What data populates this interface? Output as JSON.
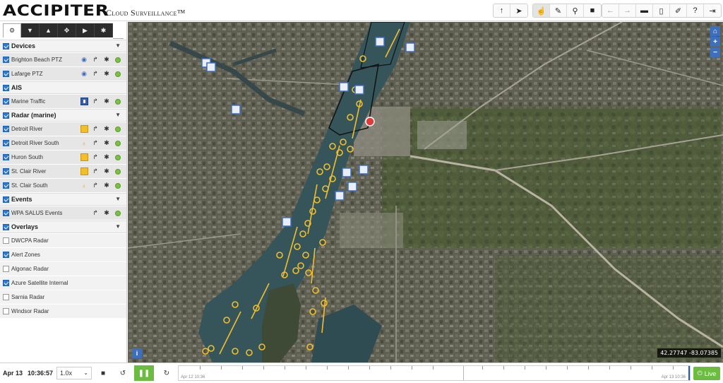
{
  "header": {
    "logo_text": "ACCIPITER",
    "product_name": "Cloud Surveillance™",
    "toolbar_left": [
      {
        "icon": "upload-arrow-icon",
        "glyph": "↑"
      },
      {
        "icon": "tag-icon",
        "glyph": "➤"
      }
    ],
    "toolbar_draw": [
      {
        "icon": "hand-pointer-icon",
        "glyph": "☝"
      },
      {
        "icon": "pencil-icon",
        "glyph": "✎"
      },
      {
        "icon": "map-pin-icon",
        "glyph": "⚲"
      },
      {
        "icon": "video-camera-icon",
        "glyph": "■"
      }
    ],
    "toolbar_right": [
      {
        "icon": "back-arrow-icon",
        "glyph": "←"
      },
      {
        "icon": "forward-arrow-icon",
        "glyph": "→"
      },
      {
        "icon": "display-toggle-icon",
        "glyph": "▬"
      },
      {
        "icon": "tablet-icon",
        "glyph": "▯"
      },
      {
        "icon": "wrench-icon",
        "glyph": "✐"
      },
      {
        "icon": "help-icon",
        "glyph": "?"
      },
      {
        "icon": "sign-out-icon",
        "glyph": "⇥"
      }
    ]
  },
  "sidebar": {
    "tabs": [
      {
        "icon": "settings-tab-icon",
        "glyph": "⚙"
      },
      {
        "icon": "filter-tab-icon",
        "glyph": "▼"
      },
      {
        "icon": "triangle-tab-icon",
        "glyph": "▲"
      },
      {
        "icon": "layers-tab-icon",
        "glyph": "✥"
      },
      {
        "icon": "camera-tab-icon",
        "glyph": "▶"
      },
      {
        "icon": "gear-tab-icon",
        "glyph": "✱"
      }
    ],
    "groups": {
      "devices": "Devices",
      "ais": "AIS",
      "radar": "Radar (marine)",
      "events": "Events",
      "overlays": "Overlays"
    },
    "devices": [
      "Brighton Beach PTZ",
      "Lafarge PTZ"
    ],
    "ais": [
      "Marine Traffic"
    ],
    "radar": [
      "Detroit River",
      "Detroit River South",
      "Huron South",
      "St. Clair River",
      "St. Clair South"
    ],
    "events": [
      "WPA SALUS Events"
    ],
    "overlays": [
      {
        "label": "DWCPA Radar",
        "checked": false
      },
      {
        "label": "Alert Zones",
        "checked": true
      },
      {
        "label": "Algonac Radar",
        "checked": false
      },
      {
        "label": "Azure Satellite Internal",
        "checked": true
      },
      {
        "label": "Sarnia Radar",
        "checked": false
      },
      {
        "label": "Windsor Radar",
        "checked": false
      }
    ]
  },
  "map": {
    "coordinates": "42.27747 -83.07385",
    "accent": "#3d6fbf",
    "track_color": "#f2bf2c"
  },
  "playback": {
    "date": "Apr 13",
    "time": "10:36:57",
    "speed": "1.0x",
    "timeline_start": "Apr 12 10:36",
    "timeline_end": "Apr 13 10:36",
    "live_label": "Live"
  }
}
